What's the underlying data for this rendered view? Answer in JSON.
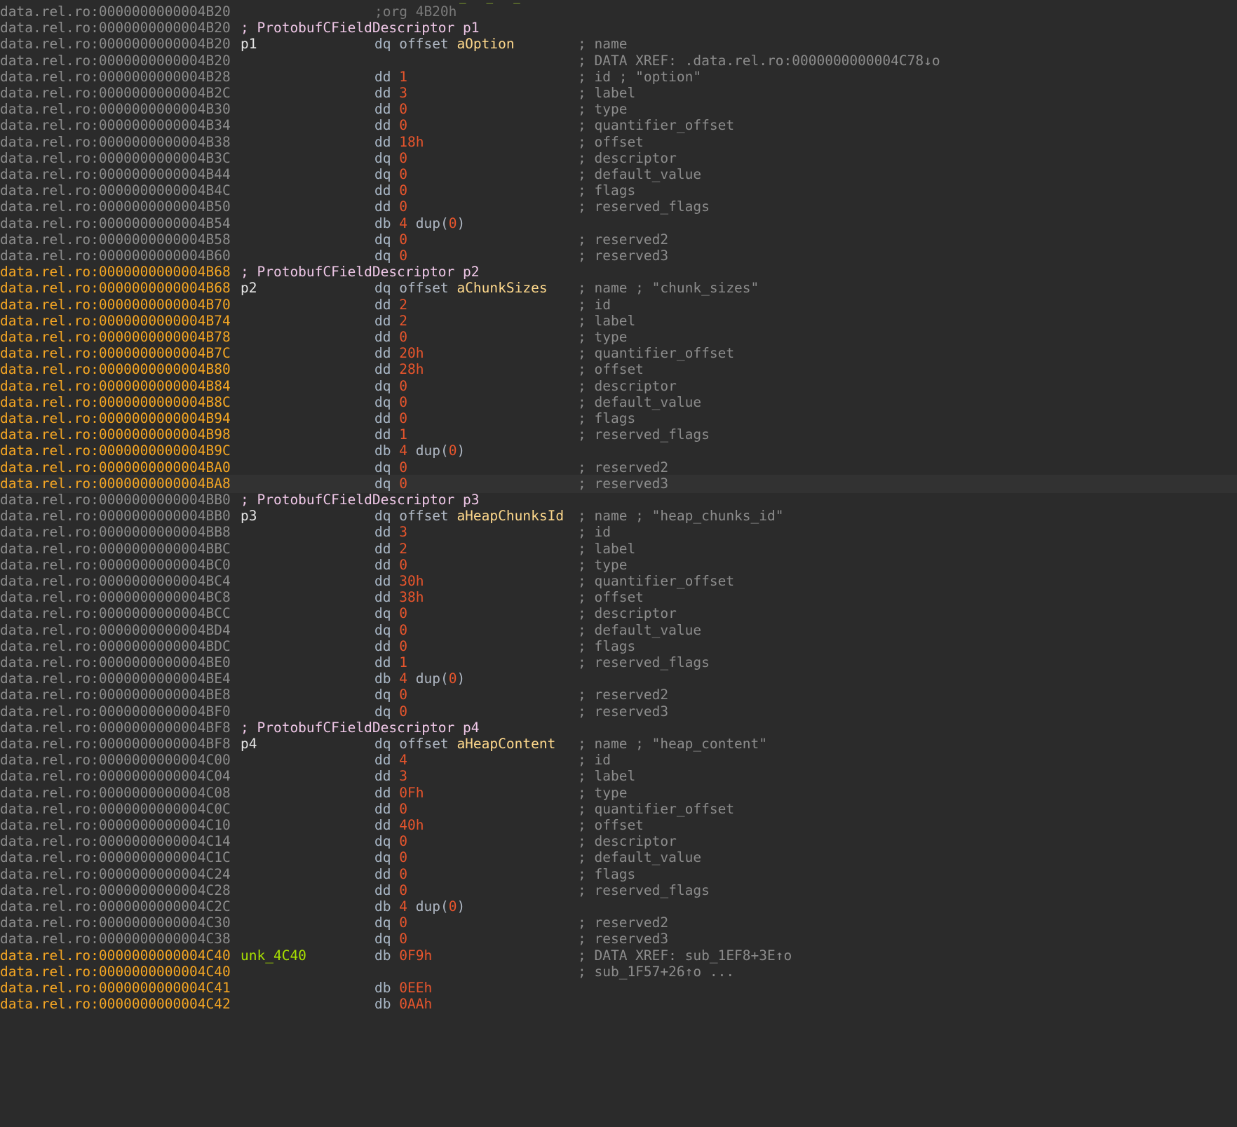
{
  "colors": {
    "background": "#2b2b2b",
    "address_normal": "#8c8c8c",
    "address_highlight": "#f5a623",
    "number": "#e8552c",
    "symbol": "#ffd98c",
    "comment": "#8c8c8c",
    "data_label": "#a8e000",
    "struct_header": "#f0c8e8"
  },
  "lines": [
    {
      "addr": "data.rel.ro:0000000000004B20",
      "org": ";org 4B20h"
    },
    {
      "addr": "data.rel.ro:0000000000004B20",
      "struct": "; ProtobufCFieldDescriptor p1"
    },
    {
      "addr": "data.rel.ro:0000000000004B20",
      "label": "p1",
      "mnem": "dq",
      "kw": "offset",
      "sym": "aOption",
      "cmt": "; name"
    },
    {
      "addr": "data.rel.ro:0000000000004B20",
      "cmt": "; DATA XREF: .data.rel.ro:0000000000004C78↓o"
    },
    {
      "addr": "data.rel.ro:0000000000004B28",
      "mnem": "dd",
      "num": "1",
      "cmt": "; id ; \"option\""
    },
    {
      "addr": "data.rel.ro:0000000000004B2C",
      "mnem": "dd",
      "num": "3",
      "cmt": "; label"
    },
    {
      "addr": "data.rel.ro:0000000000004B30",
      "mnem": "dd",
      "num": "0",
      "cmt": "; type"
    },
    {
      "addr": "data.rel.ro:0000000000004B34",
      "mnem": "dd",
      "num": "0",
      "cmt": "; quantifier_offset"
    },
    {
      "addr": "data.rel.ro:0000000000004B38",
      "mnem": "dd",
      "num": "18h",
      "cmt": "; offset"
    },
    {
      "addr": "data.rel.ro:0000000000004B3C",
      "mnem": "dq",
      "num": "0",
      "cmt": "; descriptor"
    },
    {
      "addr": "data.rel.ro:0000000000004B44",
      "mnem": "dq",
      "num": "0",
      "cmt": "; default_value"
    },
    {
      "addr": "data.rel.ro:0000000000004B4C",
      "mnem": "dd",
      "num": "0",
      "cmt": "; flags"
    },
    {
      "addr": "data.rel.ro:0000000000004B50",
      "mnem": "dd",
      "num": "0",
      "cmt": "; reserved_flags"
    },
    {
      "addr": "data.rel.ro:0000000000004B54",
      "mnem": "db",
      "num": "4",
      "dup": "0"
    },
    {
      "addr": "data.rel.ro:0000000000004B58",
      "mnem": "dq",
      "num": "0",
      "cmt": "; reserved2"
    },
    {
      "addr": "data.rel.ro:0000000000004B60",
      "mnem": "dq",
      "num": "0",
      "cmt": "; reserved3"
    },
    {
      "addr": "data.rel.ro:0000000000004B68",
      "orange": true,
      "struct": "; ProtobufCFieldDescriptor p2"
    },
    {
      "addr": "data.rel.ro:0000000000004B68",
      "orange": true,
      "label": "p2",
      "mnem": "dq",
      "kw": "offset",
      "sym": "aChunkSizes",
      "cmt": "; name ; \"chunk_sizes\""
    },
    {
      "addr": "data.rel.ro:0000000000004B70",
      "orange": true,
      "mnem": "dd",
      "num": "2",
      "cmt": "; id"
    },
    {
      "addr": "data.rel.ro:0000000000004B74",
      "orange": true,
      "mnem": "dd",
      "num": "2",
      "cmt": "; label"
    },
    {
      "addr": "data.rel.ro:0000000000004B78",
      "orange": true,
      "mnem": "dd",
      "num": "0",
      "cmt": "; type"
    },
    {
      "addr": "data.rel.ro:0000000000004B7C",
      "orange": true,
      "mnem": "dd",
      "num": "20h",
      "cmt": "; quantifier_offset"
    },
    {
      "addr": "data.rel.ro:0000000000004B80",
      "orange": true,
      "mnem": "dd",
      "num": "28h",
      "cmt": "; offset"
    },
    {
      "addr": "data.rel.ro:0000000000004B84",
      "orange": true,
      "mnem": "dq",
      "num": "0",
      "cmt": "; descriptor"
    },
    {
      "addr": "data.rel.ro:0000000000004B8C",
      "orange": true,
      "mnem": "dq",
      "num": "0",
      "cmt": "; default_value"
    },
    {
      "addr": "data.rel.ro:0000000000004B94",
      "orange": true,
      "mnem": "dd",
      "num": "0",
      "cmt": "; flags"
    },
    {
      "addr": "data.rel.ro:0000000000004B98",
      "orange": true,
      "mnem": "dd",
      "num": "1",
      "cmt": "; reserved_flags"
    },
    {
      "addr": "data.rel.ro:0000000000004B9C",
      "orange": true,
      "mnem": "db",
      "num": "4",
      "dup": "0"
    },
    {
      "addr": "data.rel.ro:0000000000004BA0",
      "orange": true,
      "mnem": "dq",
      "num": "0",
      "cmt": "; reserved2"
    },
    {
      "addr": "data.rel.ro:0000000000004BA8",
      "orange": true,
      "hl": true,
      "mnem": "dq",
      "num": "0",
      "cmt": "; reserved3"
    },
    {
      "addr": "data.rel.ro:0000000000004BB0",
      "struct": "; ProtobufCFieldDescriptor p3"
    },
    {
      "addr": "data.rel.ro:0000000000004BB0",
      "label": "p3",
      "mnem": "dq",
      "kw": "offset",
      "sym": "aHeapChunksId",
      "cmt": "; name ; \"heap_chunks_id\""
    },
    {
      "addr": "data.rel.ro:0000000000004BB8",
      "mnem": "dd",
      "num": "3",
      "cmt": "; id"
    },
    {
      "addr": "data.rel.ro:0000000000004BBC",
      "mnem": "dd",
      "num": "2",
      "cmt": "; label"
    },
    {
      "addr": "data.rel.ro:0000000000004BC0",
      "mnem": "dd",
      "num": "0",
      "cmt": "; type"
    },
    {
      "addr": "data.rel.ro:0000000000004BC4",
      "mnem": "dd",
      "num": "30h",
      "cmt": "; quantifier_offset"
    },
    {
      "addr": "data.rel.ro:0000000000004BC8",
      "mnem": "dd",
      "num": "38h",
      "cmt": "; offset"
    },
    {
      "addr": "data.rel.ro:0000000000004BCC",
      "mnem": "dq",
      "num": "0",
      "cmt": "; descriptor"
    },
    {
      "addr": "data.rel.ro:0000000000004BD4",
      "mnem": "dq",
      "num": "0",
      "cmt": "; default_value"
    },
    {
      "addr": "data.rel.ro:0000000000004BDC",
      "mnem": "dd",
      "num": "0",
      "cmt": "; flags"
    },
    {
      "addr": "data.rel.ro:0000000000004BE0",
      "mnem": "dd",
      "num": "1",
      "cmt": "; reserved_flags"
    },
    {
      "addr": "data.rel.ro:0000000000004BE4",
      "mnem": "db",
      "num": "4",
      "dup": "0"
    },
    {
      "addr": "data.rel.ro:0000000000004BE8",
      "mnem": "dq",
      "num": "0",
      "cmt": "; reserved2"
    },
    {
      "addr": "data.rel.ro:0000000000004BF0",
      "mnem": "dq",
      "num": "0",
      "cmt": "; reserved3"
    },
    {
      "addr": "data.rel.ro:0000000000004BF8",
      "struct": "; ProtobufCFieldDescriptor p4"
    },
    {
      "addr": "data.rel.ro:0000000000004BF8",
      "label": "p4",
      "mnem": "dq",
      "kw": "offset",
      "sym": "aHeapContent",
      "cmt": "; name ; \"heap_content\""
    },
    {
      "addr": "data.rel.ro:0000000000004C00",
      "mnem": "dd",
      "num": "4",
      "cmt": "; id"
    },
    {
      "addr": "data.rel.ro:0000000000004C04",
      "mnem": "dd",
      "num": "3",
      "cmt": "; label"
    },
    {
      "addr": "data.rel.ro:0000000000004C08",
      "mnem": "dd",
      "num": "0Fh",
      "cmt": "; type"
    },
    {
      "addr": "data.rel.ro:0000000000004C0C",
      "mnem": "dd",
      "num": "0",
      "cmt": "; quantifier_offset"
    },
    {
      "addr": "data.rel.ro:0000000000004C10",
      "mnem": "dd",
      "num": "40h",
      "cmt": "; offset"
    },
    {
      "addr": "data.rel.ro:0000000000004C14",
      "mnem": "dq",
      "num": "0",
      "cmt": "; descriptor"
    },
    {
      "addr": "data.rel.ro:0000000000004C1C",
      "mnem": "dq",
      "num": "0",
      "cmt": "; default_value"
    },
    {
      "addr": "data.rel.ro:0000000000004C24",
      "mnem": "dd",
      "num": "0",
      "cmt": "; flags"
    },
    {
      "addr": "data.rel.ro:0000000000004C28",
      "mnem": "dd",
      "num": "0",
      "cmt": "; reserved_flags"
    },
    {
      "addr": "data.rel.ro:0000000000004C2C",
      "mnem": "db",
      "num": "4",
      "dup": "0"
    },
    {
      "addr": "data.rel.ro:0000000000004C30",
      "mnem": "dq",
      "num": "0",
      "cmt": "; reserved2"
    },
    {
      "addr": "data.rel.ro:0000000000004C38",
      "mnem": "dq",
      "num": "0",
      "cmt": "; reserved3"
    },
    {
      "addr": "data.rel.ro:0000000000004C40",
      "orange": true,
      "glabel": "unk_4C40",
      "mnem": "db",
      "num": "0F9h",
      "cmt": "; DATA XREF: sub_1EF8+3E↑o"
    },
    {
      "addr": "data.rel.ro:0000000000004C40",
      "orange": true,
      "cmt": "; sub_1F57+26↑o ..."
    },
    {
      "addr": "data.rel.ro:0000000000004C41",
      "orange": true,
      "mnem": "db",
      "num": "0EEh"
    },
    {
      "addr": "data.rel.ro:0000000000004C42",
      "orange": true,
      "mnem": "db",
      "num": "0AAh"
    }
  ]
}
